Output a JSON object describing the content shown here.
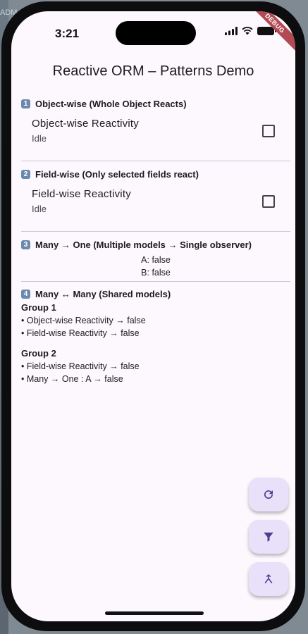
{
  "background": {
    "peek_text": "ADM"
  },
  "status_bar": {
    "time": "3:21"
  },
  "debug_banner": "DEBUG",
  "app_bar": {
    "title": "Reactive ORM – Patterns Demo"
  },
  "sections": [
    {
      "badge": "1",
      "header": "Object-wise (Whole Object Reacts)",
      "tile": {
        "title": "Object-wise Reactivity",
        "subtitle": "Idle",
        "checked": false
      }
    },
    {
      "badge": "2",
      "header": "Field-wise (Only selected fields react)",
      "tile": {
        "title": "Field-wise Reactivity",
        "subtitle": "Idle",
        "checked": false
      }
    },
    {
      "badge": "3",
      "header": "Many → One (Multiple models → Single observer)",
      "lines": [
        "A: false",
        "B: false"
      ]
    },
    {
      "badge": "4",
      "header": "Many ↔ Many (Shared models)",
      "groups": [
        {
          "title": "Group 1",
          "items": [
            "• Object-wise Reactivity → false",
            "• Field-wise Reactivity → false"
          ]
        },
        {
          "title": "Group 2",
          "items": [
            "• Field-wise Reactivity → false",
            "• Many → One : A → false"
          ]
        }
      ]
    }
  ],
  "fabs": [
    {
      "icon": "refresh-icon"
    },
    {
      "icon": "filter-icon"
    },
    {
      "icon": "merge-icon"
    }
  ],
  "colors": {
    "screen_bg": "#fdf8fe",
    "fab_bg": "#e9e1fa",
    "fab_icon": "#4a3f8f",
    "divider": "#cac4d6",
    "badge": "#6b89ad"
  }
}
